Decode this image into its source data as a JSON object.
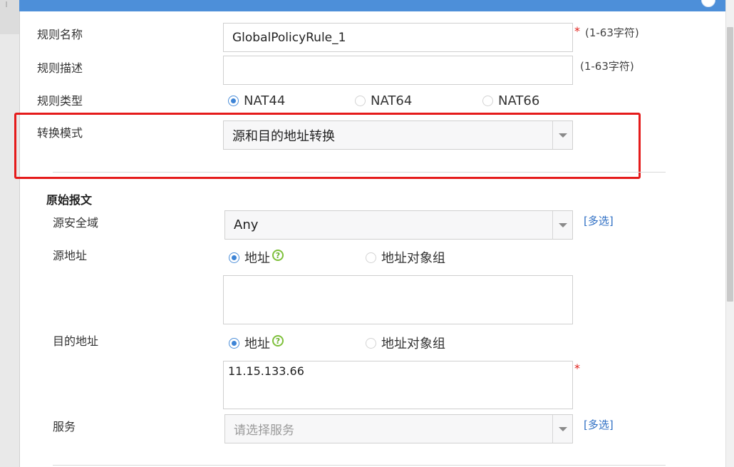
{
  "form": {
    "rule_name_label": "规则名称",
    "rule_name_value": "GlobalPolicyRule_1",
    "rule_name_hint": "(1-63字符)",
    "rule_desc_label": "规则描述",
    "rule_desc_value": "",
    "rule_desc_hint": "(1-63字符)",
    "rule_type_label": "规则类型",
    "rule_type_options": [
      {
        "label": "NAT44",
        "selected": true
      },
      {
        "label": "NAT64",
        "selected": false
      },
      {
        "label": "NAT66",
        "selected": false
      }
    ],
    "translate_mode_label": "转换模式",
    "translate_mode_value": "源和目的地址转换",
    "required_mark": "*"
  },
  "original": {
    "section_title": "原始报文",
    "src_zone_label": "源安全域",
    "src_zone_value": "Any",
    "multi_select_link": "[多选]",
    "src_addr_label": "源地址",
    "src_addr_options": [
      {
        "label": "地址",
        "selected": true
      },
      {
        "label": "地址对象组",
        "selected": false
      }
    ],
    "src_addr_value": "",
    "dst_addr_label": "目的地址",
    "dst_addr_options": [
      {
        "label": "地址",
        "selected": true
      },
      {
        "label": "地址对象组",
        "selected": false
      }
    ],
    "dst_addr_value": "11.15.133.66",
    "service_label": "服务",
    "service_placeholder": "请选择服务",
    "help_glyph": "?"
  },
  "colors": {
    "titlebar": "#4d8fd9",
    "highlight_box": "#e51b1b",
    "link": "#2f6fc4",
    "required": "#e0201a"
  }
}
